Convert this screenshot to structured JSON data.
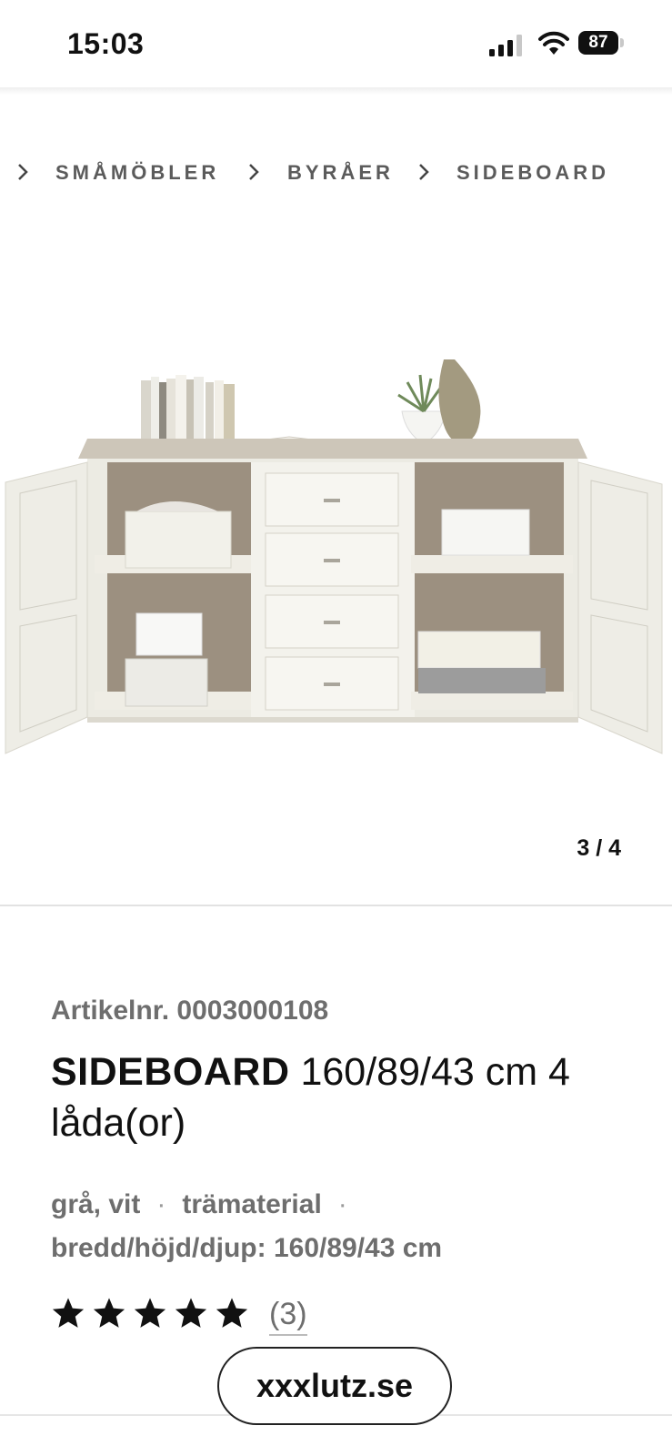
{
  "status_bar": {
    "time": "15:03",
    "battery_level": "87"
  },
  "breadcrumb": {
    "items": [
      "SMÅMÖBLER",
      "BYRÅER",
      "SIDEBOARD"
    ]
  },
  "gallery": {
    "counter": "3 / 4",
    "image_alt": "sideboard-product-image"
  },
  "product": {
    "article_number": "Artikelnr. 0003000108",
    "title_strong": "SIDEBOARD",
    "title_rest": " 160/89/43 cm 4 låda(or)",
    "attributes": [
      "grå, vit",
      "trämaterial",
      "bredd/höjd/djup: 160/89/43 cm"
    ],
    "rating": {
      "value": 5,
      "max": 5,
      "review_count": "(3)"
    }
  },
  "browser": {
    "domain": "xxxlutz.se"
  },
  "colors": {
    "text_dark": "#111111",
    "text_muted": "#6e6e6e",
    "breadcrumb": "#5b5b5b"
  }
}
